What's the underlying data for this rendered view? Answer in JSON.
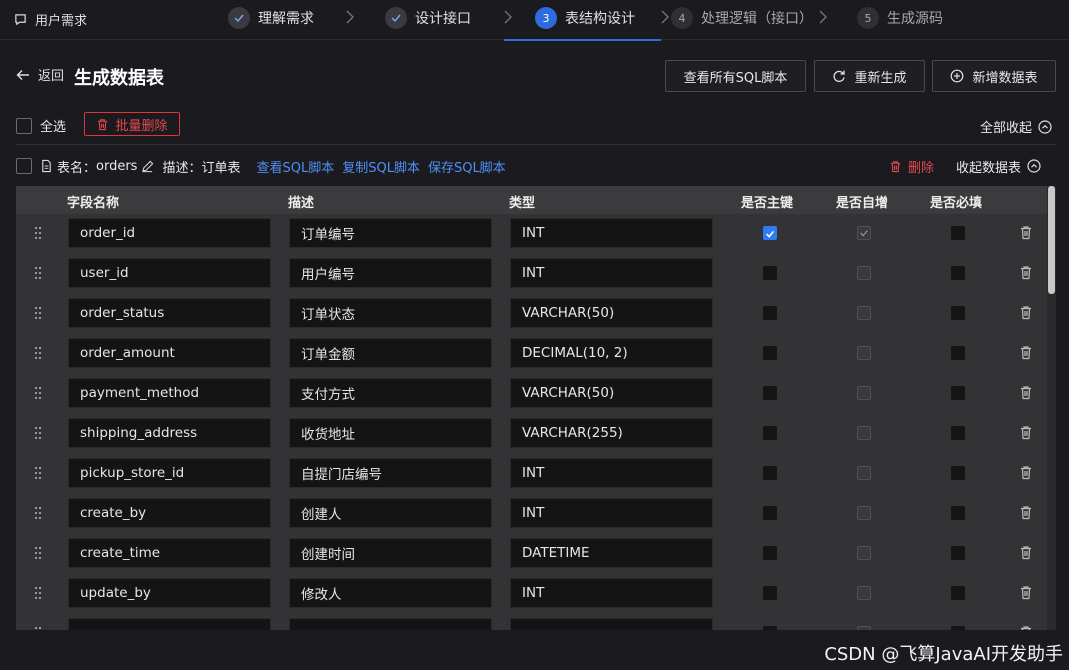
{
  "topbar": {
    "brand": "用户需求",
    "steps": [
      {
        "num": "✓",
        "label": "理解需求",
        "state": "done"
      },
      {
        "num": "✓",
        "label": "设计接口",
        "state": "done"
      },
      {
        "num": "3",
        "label": "表结构设计",
        "state": "active"
      },
      {
        "num": "4",
        "label": "处理逻辑（接口）",
        "state": "pending"
      },
      {
        "num": "5",
        "label": "生成源码",
        "state": "pending"
      }
    ]
  },
  "header": {
    "back_label": "返回",
    "title": "生成数据表",
    "buttons": {
      "view_all_sql": "查看所有SQL脚本",
      "regenerate": "重新生成",
      "add_table": "新增数据表"
    }
  },
  "toolbar": {
    "select_all": "全选",
    "batch_delete": "批量删除",
    "collapse_all": "全部收起"
  },
  "table": {
    "name_label": "表名：",
    "name": "orders",
    "desc_label": "描述：",
    "desc": "订单表",
    "view_sql": "查看SQL脚本",
    "copy_sql": "复制SQL脚本",
    "save_sql": "保存SQL脚本",
    "delete": "删除",
    "collapse": "收起数据表",
    "columns": {
      "field_name": "字段名称",
      "description": "描述",
      "type": "类型",
      "primary_key": "是否主键",
      "auto_increment": "是否自增",
      "required": "是否必填"
    },
    "rows": [
      {
        "name": "order_id",
        "desc": "订单编号",
        "type": "INT",
        "pk": true
      },
      {
        "name": "user_id",
        "desc": "用户编号",
        "type": "INT",
        "pk": false
      },
      {
        "name": "order_status",
        "desc": "订单状态",
        "type": "VARCHAR(50)",
        "pk": false
      },
      {
        "name": "order_amount",
        "desc": "订单金额",
        "type": "DECIMAL(10, 2)",
        "pk": false
      },
      {
        "name": "payment_method",
        "desc": "支付方式",
        "type": "VARCHAR(50)",
        "pk": false
      },
      {
        "name": "shipping_address",
        "desc": "收货地址",
        "type": "VARCHAR(255)",
        "pk": false
      },
      {
        "name": "pickup_store_id",
        "desc": "自提门店编号",
        "type": "INT",
        "pk": false
      },
      {
        "name": "create_by",
        "desc": "创建人",
        "type": "INT",
        "pk": false
      },
      {
        "name": "create_time",
        "desc": "创建时间",
        "type": "DATETIME",
        "pk": false
      },
      {
        "name": "update_by",
        "desc": "修改人",
        "type": "INT",
        "pk": false
      },
      {
        "name": "",
        "desc": "",
        "type": "",
        "pk": false
      }
    ]
  },
  "watermark": "CSDN @飞算JavaAI开发助手",
  "colors": {
    "accent": "#2d6cdf",
    "link": "#4f8ff7",
    "danger": "#e04a51",
    "background": "#1b1b1f"
  }
}
